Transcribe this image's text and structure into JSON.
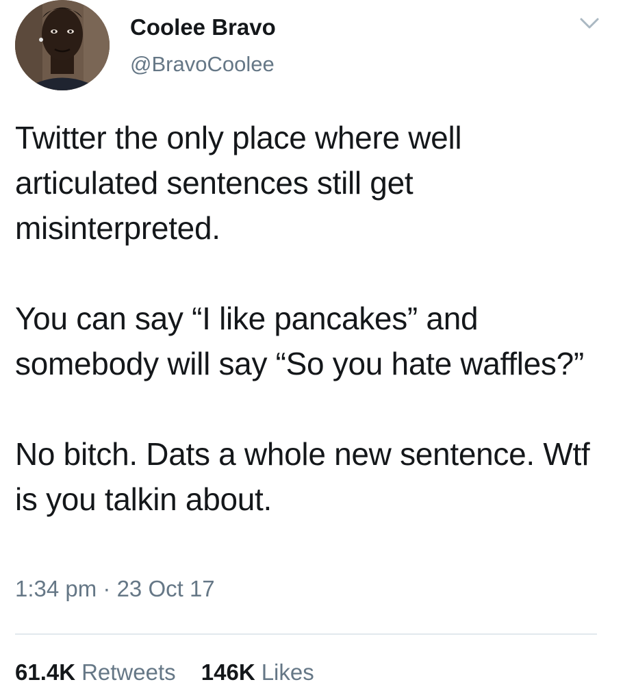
{
  "author": {
    "display_name": "Coolee Bravo",
    "handle": "@BravoCoolee",
    "avatar_icon": "profile-photo"
  },
  "menu_icon": "chevron-down-icon",
  "tweet": {
    "paragraphs": [
      "Twitter the only place where well articulated sentences still get misinterpreted.",
      "You can say “I like pancakes” and somebody will say “So you hate waffles?”",
      "No bitch. Dats a whole new sentence. Wtf is you talkin about."
    ],
    "timestamp": "1:34 pm · 23 Oct 17"
  },
  "stats": {
    "retweets_count": "61.4K",
    "retweets_label": "Retweets",
    "likes_count": "146K",
    "likes_label": "Likes"
  },
  "colors": {
    "text_primary": "#14171a",
    "text_secondary": "#657786",
    "divider": "#e1e8ed"
  }
}
